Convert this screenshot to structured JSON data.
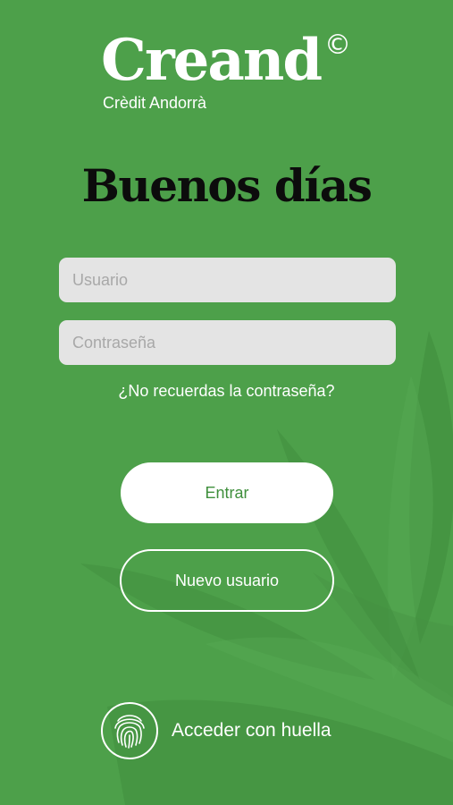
{
  "brand": {
    "name": "Creand",
    "mark": "©",
    "tagline": "Crèdit Andorrà"
  },
  "greeting": "Buenos días",
  "login": {
    "username_placeholder": "Usuario",
    "password_placeholder": "Contraseña",
    "forgot_password": "¿No recuerdas la contraseña?",
    "submit_label": "Entrar",
    "new_user_label": "Nuevo usuario"
  },
  "biometric": {
    "icon": "fingerprint-icon",
    "label": "Acceder con huella"
  },
  "colors": {
    "background": "#4da04a",
    "field_background": "#e4e4e4",
    "primary_button_text": "#3f8f3c",
    "greeting_text": "#0c0c0c"
  }
}
